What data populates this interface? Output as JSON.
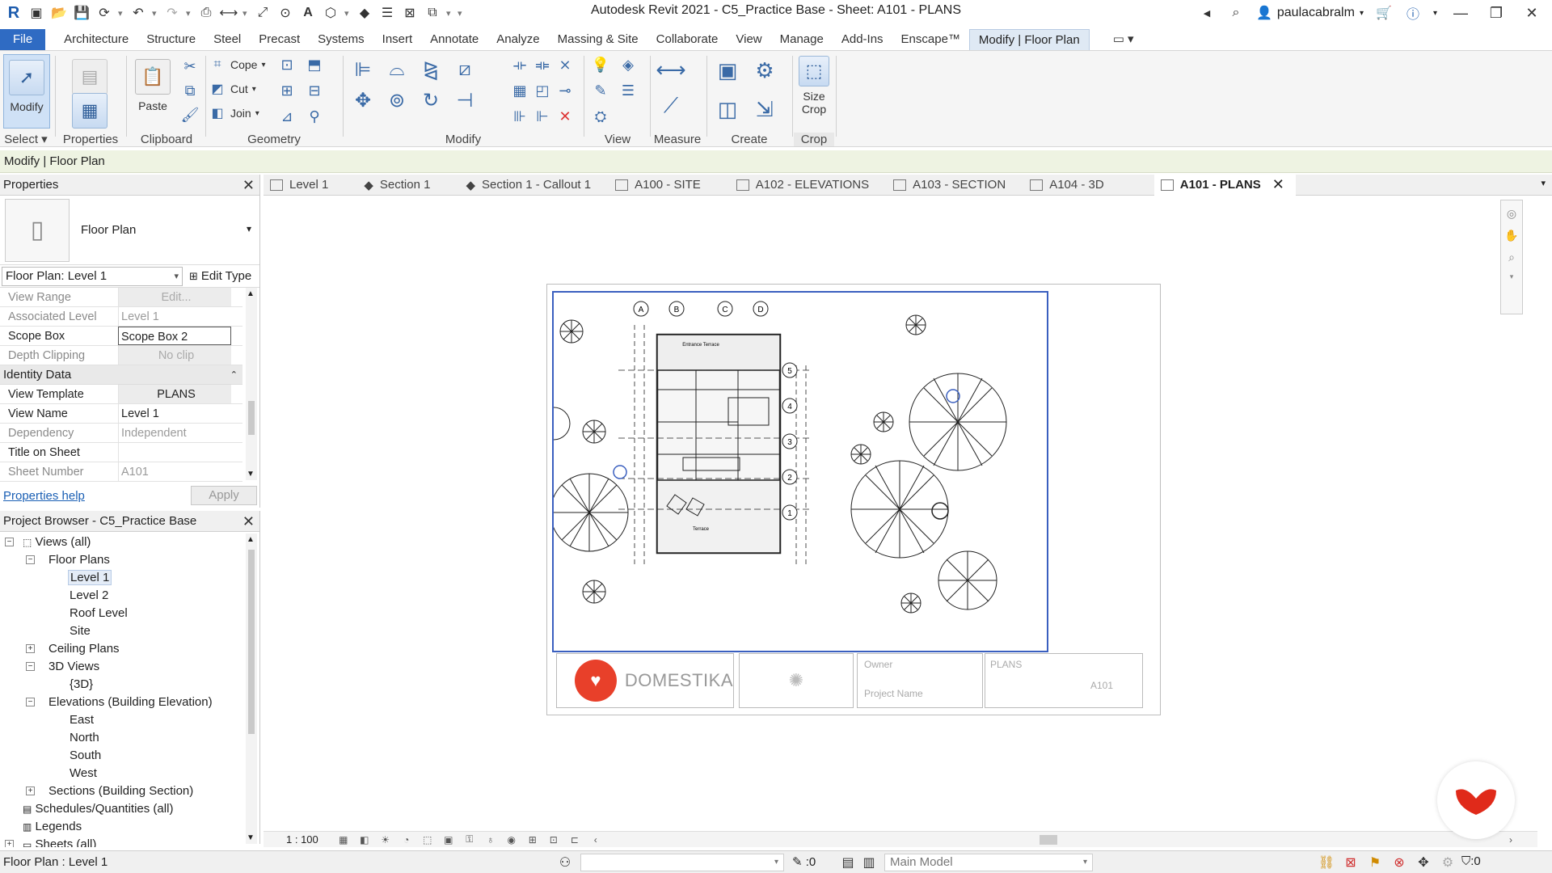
{
  "window": {
    "title": "Autodesk Revit 2021 - C5_Practice Base - Sheet: A101 - PLANS",
    "user": "paulacabralm"
  },
  "menu": {
    "file": "File",
    "tabs": [
      "Architecture",
      "Structure",
      "Steel",
      "Precast",
      "Systems",
      "Insert",
      "Annotate",
      "Analyze",
      "Massing & Site",
      "Collaborate",
      "View",
      "Manage",
      "Add-Ins",
      "Enscape™",
      "Modify | Floor Plan"
    ]
  },
  "ribbon": {
    "modify_label": "Modify",
    "paste_label": "Paste",
    "cope_label": "Cope",
    "cut_label": "Cut",
    "join_label": "Join",
    "size_crop_line1": "Size",
    "size_crop_line2": "Crop",
    "panels": {
      "select": "Select",
      "properties": "Properties",
      "clipboard": "Clipboard",
      "geometry": "Geometry",
      "modify": "Modify",
      "view": "View",
      "measure": "Measure",
      "create": "Create",
      "crop": "Crop"
    }
  },
  "context_bar": "Modify | Floor Plan",
  "properties": {
    "header": "Properties",
    "type_name": "Floor Plan",
    "instance_selector": "Floor Plan: Level 1",
    "edit_type": "Edit Type",
    "rows_top": [
      {
        "key": "View Range",
        "value": "Edit...",
        "style": "grey-btn"
      },
      {
        "key": "Associated Level",
        "value": "Level 1",
        "style": "grey"
      },
      {
        "key": "Scope Box",
        "value": "Scope Box 2",
        "style": "box"
      },
      {
        "key": "Depth Clipping",
        "value": "No clip",
        "style": "grey-btn"
      }
    ],
    "group_identity": "Identity Data",
    "rows_identity": [
      {
        "key": "View Template",
        "value": "PLANS",
        "style": "btn"
      },
      {
        "key": "View Name",
        "value": "Level 1",
        "style": "normal"
      },
      {
        "key": "Dependency",
        "value": "Independent",
        "style": "grey"
      },
      {
        "key": "Title on Sheet",
        "value": "",
        "style": "normal"
      },
      {
        "key": "Sheet Number",
        "value": "A101",
        "style": "grey"
      }
    ],
    "help_link": "Properties help",
    "apply": "Apply"
  },
  "browser": {
    "header": "Project Browser - C5_Practice Base",
    "nodes": {
      "views_all": "Views (all)",
      "floor_plans": "Floor Plans",
      "level1": "Level 1",
      "level2": "Level 2",
      "roof_level": "Roof Level",
      "site": "Site",
      "ceiling_plans": "Ceiling Plans",
      "views_3d": "3D Views",
      "view_3d": "{3D}",
      "elevations": "Elevations (Building Elevation)",
      "east": "East",
      "north": "North",
      "south": "South",
      "west": "West",
      "sections": "Sections (Building Section)",
      "schedules": "Schedules/Quantities (all)",
      "legends": "Legends",
      "sheets": "Sheets (all)"
    }
  },
  "doc_tabs": [
    "Level 1",
    "Section 1",
    "Section 1 - Callout 1",
    "A100 - SITE",
    "A102 - ELEVATIONS",
    "A103 - SECTION",
    "A104 - 3D",
    "A101 - PLANS"
  ],
  "sheet": {
    "grid_cols": [
      "A",
      "B",
      "C",
      "D"
    ],
    "grid_rows": [
      "5",
      "4",
      "3",
      "2",
      "1"
    ],
    "room_top": "Entrance Terrace",
    "room_bottom": "Terrace",
    "brand": "DOMESTIKA",
    "owner": "Owner",
    "project_name": "Project Name",
    "sheet_title": "PLANS",
    "sheet_number": "A101"
  },
  "view_control": {
    "scale": "1 : 100"
  },
  "status": {
    "left": "Floor Plan : Level 1",
    "worksets_value": ":0",
    "model": "Main Model",
    "filter_count": ":0"
  },
  "colors": {
    "accent": "#2f6bc3",
    "viewport": "#3a5fbf",
    "brand": "#e8402a",
    "context": "#eef3e2"
  }
}
